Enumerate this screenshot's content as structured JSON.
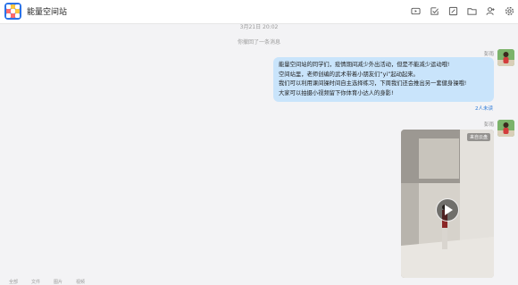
{
  "header": {
    "title": "能量空间站",
    "icons": [
      "video-icon",
      "task-check-icon",
      "edit-icon",
      "folder-icon",
      "add-member-icon",
      "settings-icon"
    ]
  },
  "timestamp": "3月21日 20:02",
  "notice": "你撤回了一条消息",
  "messages": [
    {
      "sender": "彭雨",
      "lines": [
        "能量空间站的同学们，疫情期间减少外出活动，但是不能减少运动哦!",
        "空间站里，老师创编的武术带着小朋友们“yi”起动起来。",
        "我们可以利用课间操时间自主选择练习，下周我们还会推出另一套健身操哦!",
        "大家可以拍摄小视频留下你体育小达人的身影!"
      ],
      "read_status": "2人未读"
    },
    {
      "sender": "彭雨",
      "video_badge": "来自云盘"
    }
  ],
  "bottom_bar": [
    "全部",
    "文件",
    "图片",
    "视频"
  ],
  "colors": {
    "bubble": "#c9e4fb",
    "accent": "#2d7bd8"
  }
}
